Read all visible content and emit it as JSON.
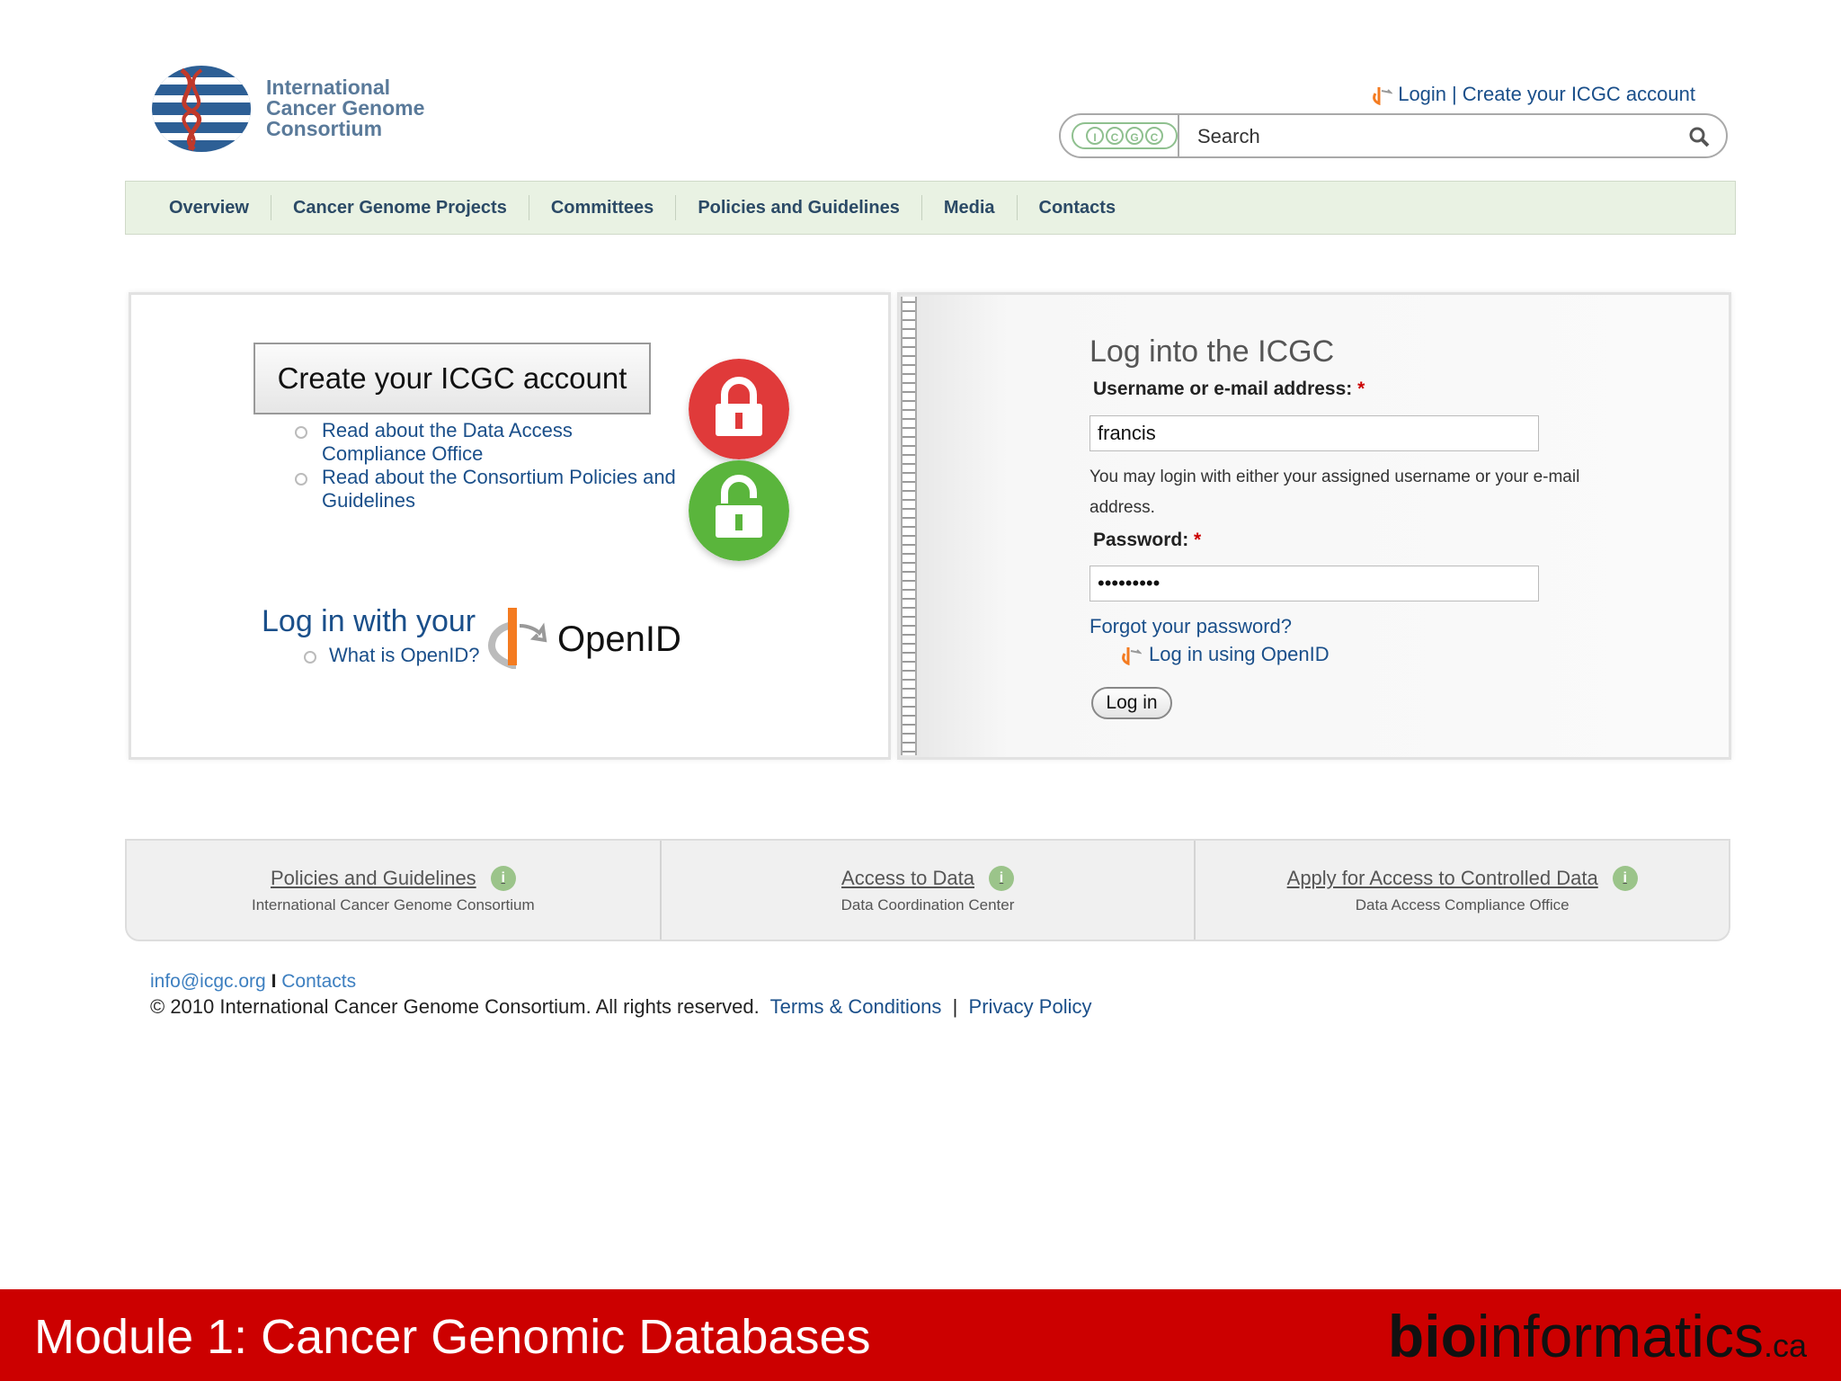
{
  "header": {
    "logo_lines": [
      "International",
      "Cancer Genome",
      "Consortium"
    ],
    "login_link": "Login",
    "separator": "|",
    "create_link": "Create your ICGC account",
    "icgc_letters": [
      "I",
      "C",
      "G",
      "C"
    ],
    "search_placeholder": "Search"
  },
  "nav": {
    "items": [
      "Overview",
      "Cancer Genome Projects",
      "Committees",
      "Policies and Guidelines",
      "Media",
      "Contacts"
    ]
  },
  "left_panel": {
    "create_button": "Create your ICGC account",
    "links": [
      "Read about the Data Access Compliance Office",
      "Read about the Consortium Policies and Guidelines"
    ],
    "openid_heading": "Log in with your",
    "openid_what": "What is OpenID?",
    "openid_logo_text": "OpenID",
    "lock_colors": {
      "locked": "#e03a3a",
      "unlocked": "#5ab53c"
    }
  },
  "login": {
    "title": "Log into the ICGC",
    "username_label": "Username or e-mail address:",
    "required_mark": "*",
    "username_value": "francis",
    "help_text": "You may login with either your assigned username or your e-mail address.",
    "password_label": "Password:",
    "password_value": "•••••••••",
    "forgot": "Forgot your password?",
    "openid_login": "Log in using OpenID",
    "login_button": "Log in"
  },
  "footer_boxes": [
    {
      "title": "Policies and Guidelines",
      "subtitle": "International Cancer Genome Consortium"
    },
    {
      "title": "Access to Data",
      "subtitle": "Data Coordination Center"
    },
    {
      "title": "Apply for Access to Controlled Data",
      "subtitle": "Data Access Compliance Office"
    }
  ],
  "footer": {
    "email": "info@icgc.org",
    "sep": "I",
    "contacts": "Contacts",
    "copyright": "© 2010 International Cancer Genome Consortium. All rights reserved.",
    "terms": "Terms & Conditions",
    "pipe": "|",
    "privacy": "Privacy Policy"
  },
  "slide": {
    "title": "Module 1: Cancer Genomic Databases",
    "brand_bold": "bio",
    "brand_rest": "informatics",
    "brand_suffix": ".ca",
    "banner_color": "#cc0000"
  }
}
